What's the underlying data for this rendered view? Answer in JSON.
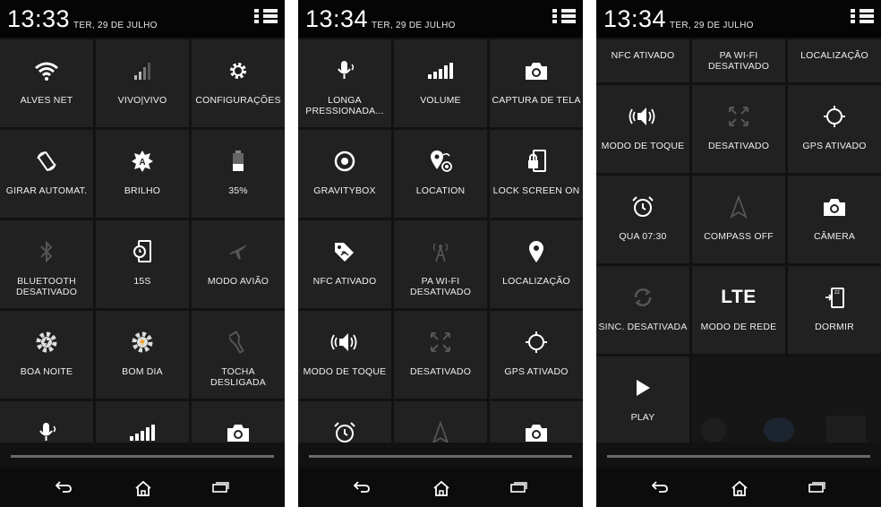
{
  "panels": [
    {
      "time": "13:33",
      "date": "TER, 29 DE JULHO",
      "tiles": [
        {
          "label": "ALVES NET",
          "icon": "wifi-icon"
        },
        {
          "label": "VIVO|VIVO",
          "icon": "signal-icon"
        },
        {
          "label": "CONFIGURAÇÕES",
          "icon": "gear-icon"
        },
        {
          "label": "GIRAR AUTOMAT.",
          "icon": "rotate-icon"
        },
        {
          "label": "BRILHO",
          "icon": "brightness-icon"
        },
        {
          "label": "35%",
          "icon": "battery-icon"
        },
        {
          "label": "BLUETOOTH\nDESATIVADO",
          "icon": "bluetooth-icon"
        },
        {
          "label": "15S",
          "icon": "screen-timeout-icon"
        },
        {
          "label": "MODO AVIÃO",
          "icon": "airplane-icon"
        },
        {
          "label": "BOA NOITE",
          "icon": "tasker-icon"
        },
        {
          "label": "BOM DIA",
          "icon": "tasker-icon"
        },
        {
          "label": "TOCHA\nDESLIGADA",
          "icon": "flashlight-icon"
        },
        {
          "label": "",
          "icon": "microphone-icon"
        },
        {
          "label": "",
          "icon": "volume-bars-icon"
        },
        {
          "label": "",
          "icon": "camera-icon"
        }
      ]
    },
    {
      "time": "13:34",
      "date": "TER, 29 DE JULHO",
      "tiles": [
        {
          "label": "LONGA\nPRESSIONADA...",
          "icon": "microphone-icon"
        },
        {
          "label": "VOLUME",
          "icon": "volume-bars-icon"
        },
        {
          "label": "CAPTURA DE TELA",
          "icon": "camera-icon"
        },
        {
          "label": "GRAVITYBOX",
          "icon": "target-icon"
        },
        {
          "label": "LOCATION",
          "icon": "location-icon"
        },
        {
          "label": "LOCK SCREEN ON",
          "icon": "lock-screen-icon"
        },
        {
          "label": "NFC ATIVADO",
          "icon": "nfc-icon"
        },
        {
          "label": "PA WI-FI\nDESATIVADO",
          "icon": "hotspot-icon"
        },
        {
          "label": "LOCALIZAÇÃO",
          "icon": "pin-icon"
        },
        {
          "label": "MODO DE TOQUE",
          "icon": "speaker-icon"
        },
        {
          "label": "DESATIVADO",
          "icon": "expand-icon"
        },
        {
          "label": "GPS ATIVADO",
          "icon": "crosshair-icon"
        },
        {
          "label": "",
          "icon": "alarm-icon"
        },
        {
          "label": "",
          "icon": "compass-icon"
        },
        {
          "label": "",
          "icon": "camera-icon"
        }
      ]
    },
    {
      "time": "13:34",
      "date": "TER, 29 DE JULHO",
      "tiles": [
        {
          "label": "NFC ATIVADO",
          "icon": "nfc-icon"
        },
        {
          "label": "PA WI-FI\nDESATIVADO",
          "icon": "hotspot-icon"
        },
        {
          "label": "LOCALIZAÇÃO",
          "icon": "pin-icon"
        },
        {
          "label": "MODO DE TOQUE",
          "icon": "speaker-icon"
        },
        {
          "label": "DESATIVADO",
          "icon": "expand-icon"
        },
        {
          "label": "GPS ATIVADO",
          "icon": "crosshair-icon"
        },
        {
          "label": "QUA 07:30",
          "icon": "alarm-icon"
        },
        {
          "label": "COMPASS OFF",
          "icon": "compass-icon"
        },
        {
          "label": "CÂMERA",
          "icon": "camera-icon"
        },
        {
          "label": "SINC. DESATIVADA",
          "icon": "sync-icon"
        },
        {
          "label": "MODO DE REDE",
          "icon": "lte-icon",
          "glyph": "LTE"
        },
        {
          "label": "DORMIR",
          "icon": "sleep-icon"
        },
        {
          "label": "PLAY",
          "icon": "play-icon"
        }
      ]
    }
  ],
  "colors": {
    "tile": "#212121",
    "panel": "#121212",
    "text": "#f0f0f0",
    "dim_icon": "#5a5a5a"
  }
}
